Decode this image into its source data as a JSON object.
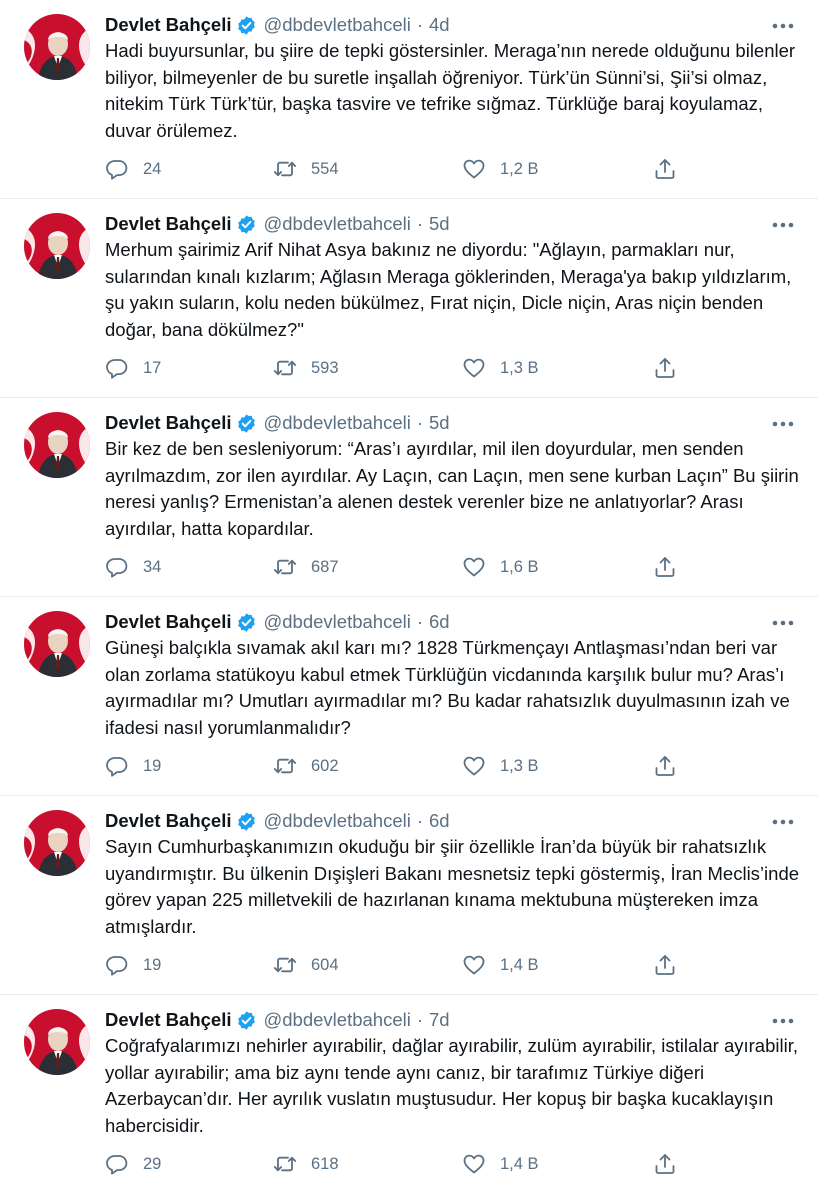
{
  "colors": {
    "text": "#0f1419",
    "muted": "#5b7083",
    "verified": "#1da1f2",
    "divider": "#e6ecf0"
  },
  "icons": {
    "reply": "reply-icon",
    "retweet": "retweet-icon",
    "like": "heart-icon",
    "share": "share-icon",
    "more": "more-icon",
    "verified": "verified-badge-icon"
  },
  "tweets": [
    {
      "name": "Devlet Bahçeli",
      "handle": "@dbdevletbahceli",
      "time": "4d",
      "text": "Hadi buyursunlar, bu şiire de tepki göstersinler. Meraga’nın nerede olduğunu bilenler biliyor, bilmeyenler de bu suretle inşallah öğreniyor. Türk’ün Sünni’si, Şii’si olmaz, nitekim Türk Türk’tür, başka tasvire ve tefrike sığmaz. Türklüğe baraj koyulamaz, duvar örülemez.",
      "replies": "24",
      "retweets": "554",
      "likes": "1,2 B"
    },
    {
      "name": "Devlet Bahçeli",
      "handle": "@dbdevletbahceli",
      "time": "5d",
      "text": "Merhum şairimiz Arif Nihat Asya bakınız ne diyordu: \"Ağlayın, parmakları nur, sularından kınalı kızlarım; Ağlasın Meraga göklerinden, Meraga'ya bakıp yıldızlarım, şu yakın suların, kolu neden bükülmez, Fırat niçin, Dicle niçin, Aras niçin benden doğar, bana dökülmez?\"",
      "replies": "17",
      "retweets": "593",
      "likes": "1,3 B"
    },
    {
      "name": "Devlet Bahçeli",
      "handle": "@dbdevletbahceli",
      "time": "5d",
      "text": "Bir kez de ben sesleniyorum: “Aras’ı ayırdılar, mil ilen doyurdular, men senden ayrılmazdım, zor ilen ayırdılar. Ay Laçın, can Laçın, men sene kurban Laçın” Bu şiirin neresi yanlış? Ermenistan’a alenen destek verenler bize ne anlatıyorlar? Arası ayırdılar, hatta kopardılar.",
      "replies": "34",
      "retweets": "687",
      "likes": "1,6 B"
    },
    {
      "name": "Devlet Bahçeli",
      "handle": "@dbdevletbahceli",
      "time": "6d",
      "text": "Güneşi balçıkla sıvamak akıl karı mı? 1828 Türkmençayı Antlaşması’ndan beri var olan zorlama statükoyu kabul etmek Türklüğün vicdanında karşılık bulur mu? Aras’ı ayırmadılar mı? Umutları ayırmadılar mı? Bu kadar rahatsızlık duyulmasının izah ve ifadesi nasıl yorumlanmalıdır?",
      "replies": "19",
      "retweets": "602",
      "likes": "1,3 B"
    },
    {
      "name": "Devlet Bahçeli",
      "handle": "@dbdevletbahceli",
      "time": "6d",
      "text": "Sayın Cumhurbaşkanımızın okuduğu bir şiir özellikle İran’da büyük bir rahatsızlık uyandırmıştır. Bu ülkenin Dışişleri Bakanı mesnetsiz tepki göstermiş, İran Meclis’inde görev yapan 225 milletvekili de hazırlanan kınama mektubuna müştereken imza atmışlardır.",
      "replies": "19",
      "retweets": "604",
      "likes": "1,4 B"
    },
    {
      "name": "Devlet Bahçeli",
      "handle": "@dbdevletbahceli",
      "time": "7d",
      "text": "Coğrafyalarımızı nehirler ayırabilir, dağlar ayırabilir, zulüm ayırabilir, istilalar ayırabilir, yollar ayırabilir; ama biz aynı tende aynı canız, bir tarafımız Türkiye diğeri Azerbaycan’dır. Her ayrılık vuslatın muştusudur. Her kopuş bir başka kucaklayışın habercisidir.",
      "replies": "29",
      "retweets": "618",
      "likes": "1,4 B"
    }
  ]
}
